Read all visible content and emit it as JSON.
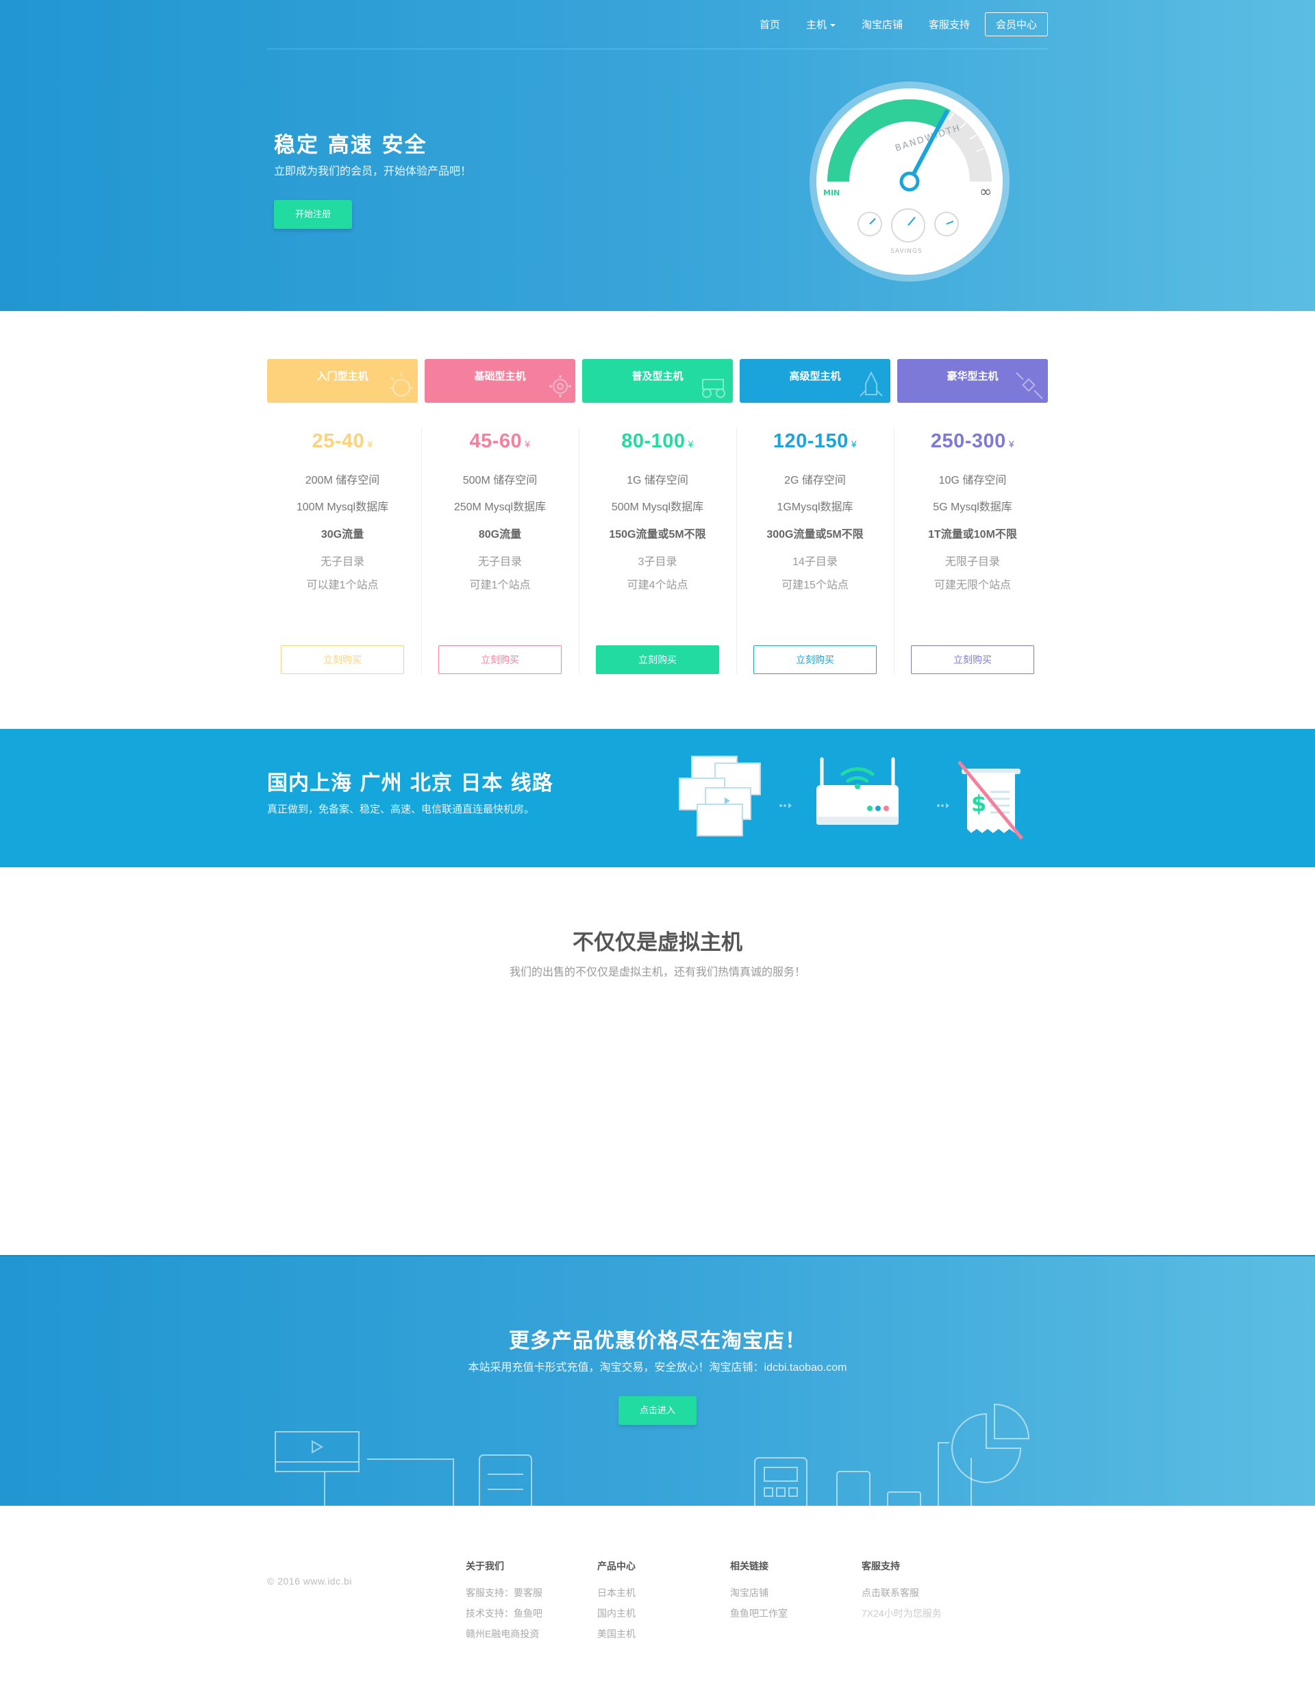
{
  "nav": {
    "items": [
      {
        "label": "首页",
        "caret": false
      },
      {
        "label": "主机",
        "caret": true
      },
      {
        "label": "淘宝店铺",
        "caret": false
      },
      {
        "label": "客服支持",
        "caret": false
      }
    ],
    "member": "会员中心"
  },
  "hero": {
    "title": "稳定 高速 安全",
    "subtitle": "立即成为我们的会员，开始体验产品吧！",
    "button": "开始注册",
    "gauge": {
      "label_main": "BANDWIDTH",
      "label_min": "MIN",
      "label_max": "∞",
      "label_savings": "SAVINGS"
    }
  },
  "plans": [
    {
      "name": "入门型主机",
      "price": "25-40",
      "yen": "¥",
      "color": "#fdd27a",
      "features": [
        "200M 储存空间",
        "100M Mysql数据库",
        "30G流量",
        "无子目录",
        "可以建1个站点"
      ],
      "button": "立刻购买",
      "filled": false
    },
    {
      "name": "基础型主机",
      "price": "45-60",
      "yen": "¥",
      "color": "#f5809e",
      "features": [
        "500M 储存空间",
        "250M Mysql数据库",
        "80G流量",
        "无子目录",
        "可建1个站点"
      ],
      "button": "立刻购买",
      "filled": false
    },
    {
      "name": "普及型主机",
      "price": "80-100",
      "yen": "¥",
      "color": "#22dba0",
      "features": [
        "1G 储存空间",
        "500M Mysql数据库",
        "150G流量或5M不限",
        "3子目录",
        "可建4个站点"
      ],
      "button": "立刻购买",
      "filled": true
    },
    {
      "name": "高级型主机",
      "price": "120-150",
      "yen": "¥",
      "color": "#1ba4dc",
      "features": [
        "2G 储存空间",
        "1GMysql数据库",
        "300G流量或5M不限",
        "14子目录",
        "可建15个站点"
      ],
      "button": "立刻购买",
      "filled": false
    },
    {
      "name": "豪华型主机",
      "price": "250-300",
      "yen": "¥",
      "color": "#7c79d8",
      "features": [
        "10G 储存空间",
        "5G Mysql数据库",
        "1T流量或10M不限",
        "无限子目录",
        "可建无限个站点"
      ],
      "button": "立刻购买",
      "filled": false
    }
  ],
  "band": {
    "title": "国内上海 广州 北京 日本 线路",
    "subtitle": "真正做到，免备案、稳定、高速、电信联通直连最快机房。",
    "dollar": "$"
  },
  "services": {
    "title": "不仅仅是虚拟主机",
    "subtitle": "我们的出售的不仅仅是虚拟主机，还有我们热情真诚的服务！"
  },
  "cta": {
    "title": "更多产品优惠价格尽在淘宝店！",
    "subtitle": "本站采用充值卡形式充值，淘宝交易，安全放心！淘宝店铺：idcbi.taobao.com",
    "button": "点击进入"
  },
  "footer": {
    "copyright": "© 2016 www.idc.bi",
    "columns": [
      {
        "title": "关于我们",
        "links": [
          "客服支持：要客服",
          "技术支持：鱼鱼吧",
          "赣州E融电商投资"
        ]
      },
      {
        "title": "产品中心",
        "links": [
          "日本主机",
          "国内主机",
          "美国主机"
        ]
      },
      {
        "title": "相关链接",
        "links": [
          "淘宝店铺",
          "鱼鱼吧工作室"
        ]
      },
      {
        "title": "客服支持",
        "links": [
          "点击联系客服",
          "7X24小时为您服务"
        ]
      }
    ]
  }
}
